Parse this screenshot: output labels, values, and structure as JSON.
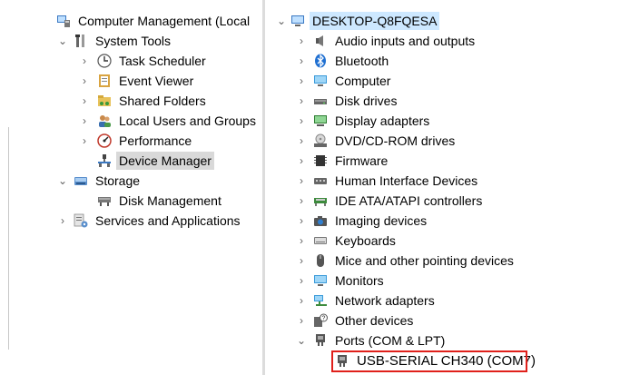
{
  "left_tree": {
    "root": "Computer Management (Local",
    "system_tools": "System Tools",
    "task_scheduler": "Task Scheduler",
    "event_viewer": "Event Viewer",
    "shared_folders": "Shared Folders",
    "local_users": "Local Users and Groups",
    "performance": "Performance",
    "device_manager": "Device Manager",
    "storage": "Storage",
    "disk_management": "Disk Management",
    "services": "Services and Applications"
  },
  "right_tree": {
    "computer_name": "DESKTOP-Q8FQESA",
    "categories": [
      "Audio inputs and outputs",
      "Bluetooth",
      "Computer",
      "Disk drives",
      "Display adapters",
      "DVD/CD-ROM drives",
      "Firmware",
      "Human Interface Devices",
      "IDE ATA/ATAPI controllers",
      "Imaging devices",
      "Keyboards",
      "Mice and other pointing devices",
      "Monitors",
      "Network adapters",
      "Other devices",
      "Ports (COM & LPT)"
    ],
    "port_device": "USB-SERIAL CH340 (COM7)"
  },
  "colors": {
    "highlight_border": "#e0201b",
    "selection": "#cde8ff"
  }
}
